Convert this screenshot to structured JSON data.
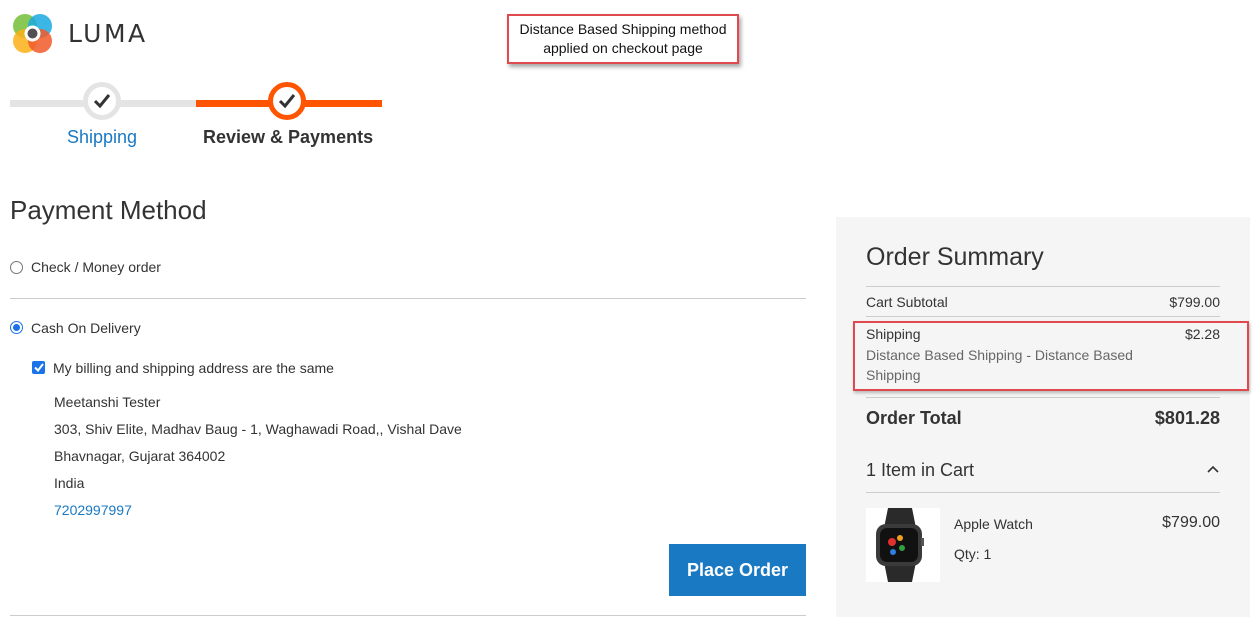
{
  "brand": {
    "name": "LUMA"
  },
  "annotation": {
    "line1": "Distance Based Shipping method",
    "line2": "applied on checkout page"
  },
  "progress": {
    "steps": [
      {
        "label": "Shipping",
        "state": "complete"
      },
      {
        "label": "Review & Payments",
        "state": "active"
      }
    ]
  },
  "payment": {
    "title": "Payment Method",
    "methods": [
      {
        "label": "Check / Money order",
        "selected": false
      },
      {
        "label": "Cash On Delivery",
        "selected": true
      }
    ],
    "same_address_label": "My billing and shipping address are the same",
    "address": {
      "name": "Meetanshi Tester",
      "street": "303, Shiv Elite, Madhav Baug - 1, Waghawadi Road,, Vishal Dave",
      "city": "Bhavnagar, Gujarat 364002",
      "country": "India",
      "phone": "7202997997"
    },
    "place_order_label": "Place Order"
  },
  "summary": {
    "title": "Order Summary",
    "subtotal_label": "Cart Subtotal",
    "subtotal_value": "$799.00",
    "shipping_label": "Shipping",
    "shipping_value": "$2.28",
    "shipping_method": "Distance Based Shipping - Distance Based Shipping",
    "total_label": "Order Total",
    "total_value": "$801.28",
    "items_label": "1 Item in Cart",
    "item": {
      "name": "Apple Watch",
      "price": "$799.00",
      "qty_label": "Qty: 1"
    }
  },
  "colors": {
    "accent_orange": "#ff5501",
    "link_blue": "#1979c3",
    "highlight_red": "#e0494d"
  }
}
